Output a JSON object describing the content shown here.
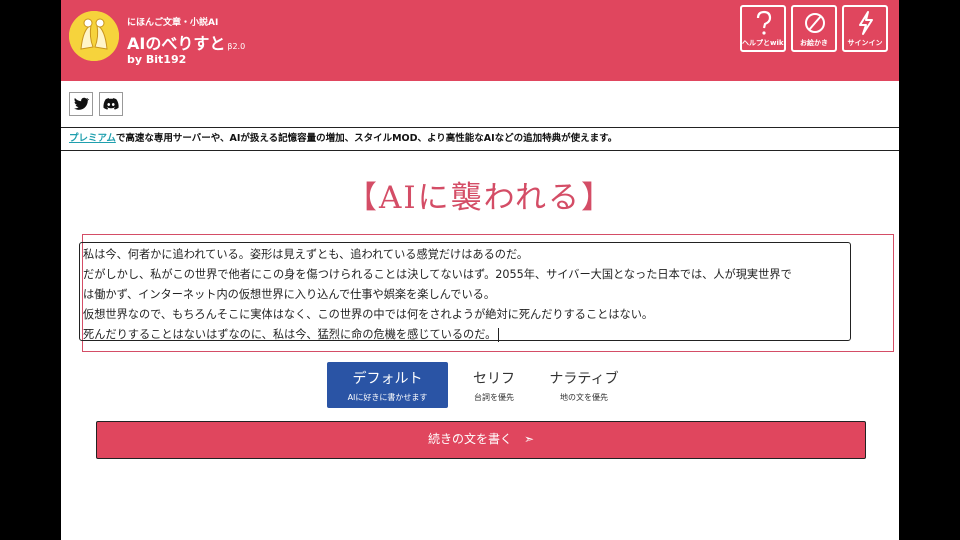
{
  "header": {
    "tagline": "にほんご文章・小説AI",
    "title": "AIのべりすと",
    "beta": "β2.0",
    "byline": "by Bit192",
    "bg_color": "#e0465e",
    "buttons": [
      {
        "label": "ヘルプとwiki",
        "icon": "question-icon"
      },
      {
        "label": "お絵かき",
        "icon": "brush-icon"
      },
      {
        "label": "サインイン",
        "icon": "lightning-icon"
      }
    ]
  },
  "social": [
    {
      "icon": "twitter-icon"
    },
    {
      "icon": "discord-icon"
    }
  ],
  "promo": {
    "link": "プレミアム",
    "text": "で高速な専用サーバーや、AIが扱える記憶容量の増加、スタイルMOD、より高性能なAIなどの追加特典が使えます。"
  },
  "story_title": "【AIに襲われる】",
  "editor": {
    "lines": [
      "私は今、何者かに追われている。姿形は見えずとも、追われている感覚だけはあるのだ。",
      "だがしかし、私がこの世界で他者にこの身を傷つけられることは決してないはず。2055年、サイバー大国となった日本では、人が現実世界で",
      "は働かず、インターネット内の仮想世界に入り込んで仕事や娯楽を楽しんでいる。",
      "仮想世界なので、もちろんそこに実体はなく、この世界の中では何をされようが絶対に死んだりすることはない。",
      "死んだりすることはないはずなのに、私は今、猛烈に命の危機を感じているのだ。"
    ]
  },
  "modes": [
    {
      "label": "デフォルト",
      "sub": "AIに好きに書かせます",
      "active": true
    },
    {
      "label": "セリフ",
      "sub": "台詞を優先",
      "active": false
    },
    {
      "label": "ナラティブ",
      "sub": "地の文を優先",
      "active": false
    }
  ],
  "continue_button": "続きの文を書く　➣",
  "colors": {
    "accent": "#e0465e",
    "mode_active": "#2a54a5",
    "link": "#1f9fae",
    "title": "#d44d66"
  }
}
